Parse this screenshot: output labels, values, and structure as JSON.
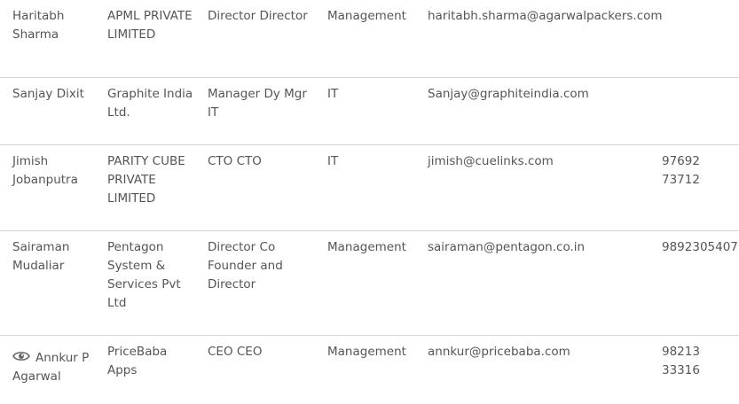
{
  "contacts": [
    {
      "name": "Haritabh Sharma",
      "company": "APML PRIVATE LIMITED",
      "designation": "Director Director",
      "department": "Management",
      "email": "haritabh.sharma@agarwalpackers.com",
      "phone": ""
    },
    {
      "name": "Sanjay Dixit",
      "company": "Graphite India Ltd.",
      "designation": "Manager Dy Mgr IT",
      "department": "IT",
      "email": "Sanjay@graphiteindia.com",
      "phone": ""
    },
    {
      "name": "Jimish Jobanputra",
      "company": "PARITY CUBE PRIVATE LIMITED",
      "designation": "CTO CTO",
      "department": "IT",
      "email": "jimish@cuelinks.com",
      "phone": "97692 73712"
    },
    {
      "name": "Sairaman Mudaliar",
      "company": "Pentagon System & Services Pvt Ltd",
      "designation": "Director Co Founder and Director",
      "department": "Management",
      "email": "sairaman@pentagon.co.in",
      "phone": "9892305407"
    },
    {
      "name": "Annkur P Agarwal",
      "name_icon": "eye-icon",
      "company": "PriceBaba Apps",
      "designation": "CEO CEO",
      "department": "Management",
      "email": "annkur@pricebaba.com",
      "phone": "98213 33316"
    }
  ],
  "colors": {
    "text": "#555555",
    "row_border": "#d6d6d6",
    "icon": "#666666",
    "background": "#ffffff"
  }
}
